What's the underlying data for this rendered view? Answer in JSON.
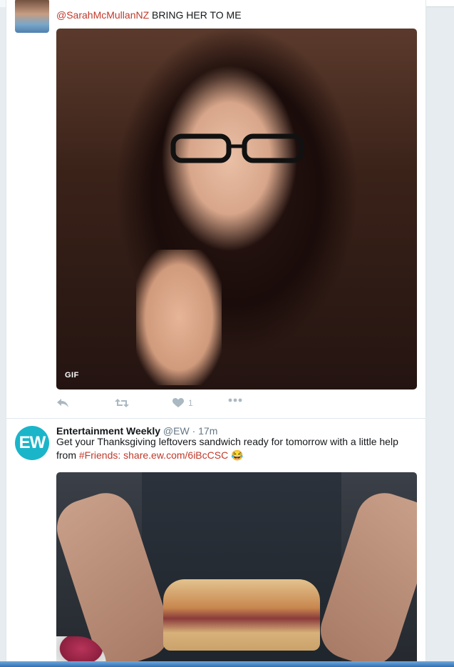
{
  "tweet1": {
    "mention": "@SarahMcMullanNZ",
    "text": " BRING HER TO ME",
    "gif_label": "GIF",
    "like_count": "1"
  },
  "tweet2": {
    "avatar_text": "EW",
    "fullname": "Entertainment Weekly",
    "handle": "@EW",
    "separator": "·",
    "time": "17m",
    "text_before": "Get your Thanksgiving leftovers sandwich ready for tomorrow with a little help from ",
    "hashtag": "#Friends",
    "colon": ": ",
    "link": "share.ew.com/6iBcCSC",
    "emoji": "😂"
  },
  "icons": {
    "reply": "reply-icon",
    "retweet": "retweet-icon",
    "like": "heart-icon",
    "more": "more-icon"
  },
  "colors": {
    "link": "#c0392b",
    "muted": "#657786",
    "icon": "#aab8c2",
    "ew_brand": "#1bb5c9"
  }
}
